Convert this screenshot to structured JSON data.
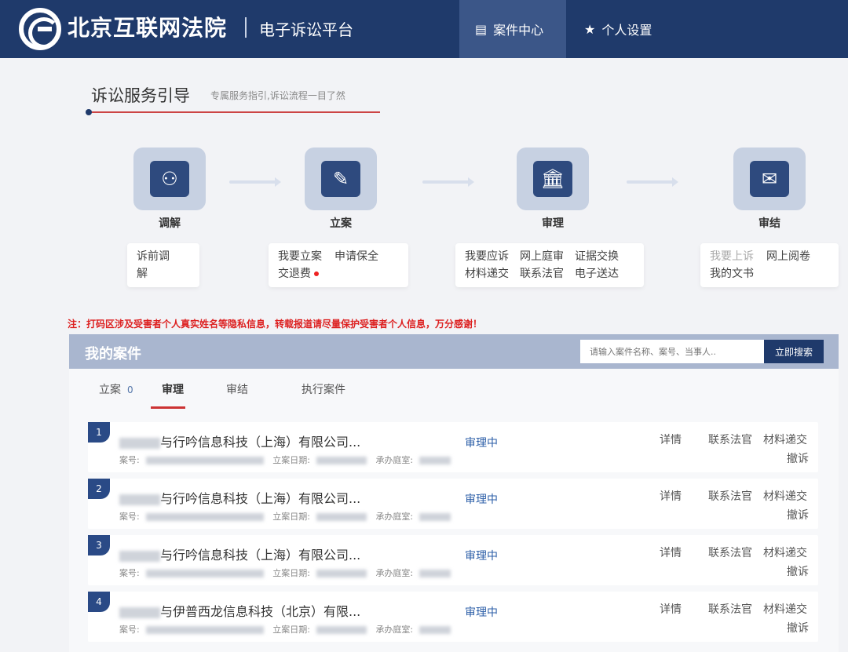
{
  "header": {
    "court_name": "北京互联网法院",
    "platform_name": "电子诉讼平台",
    "nav": [
      {
        "label": "案件中心",
        "icon": "list-icon",
        "active": true
      },
      {
        "label": "个人设置",
        "icon": "star-icon",
        "active": false
      }
    ],
    "colors": {
      "primary": "#1f3a6b",
      "active_tab": "#3b5688",
      "accent_red": "#cc3333"
    }
  },
  "guide": {
    "title": "诉讼服务引导",
    "subtitle": "专属服务指引,诉讼流程一目了然",
    "steps": [
      {
        "label": "调解",
        "icon": "mediation-icon",
        "links": [
          "诉前调解"
        ]
      },
      {
        "label": "立案",
        "icon": "filing-icon",
        "links": [
          "我要立案",
          "申请保全",
          "交退费"
        ]
      },
      {
        "label": "审理",
        "icon": "court-icon",
        "links": [
          "我要应诉",
          "网上庭审",
          "证据交换",
          "材料递交",
          "联系法官",
          "电子送达"
        ]
      },
      {
        "label": "审结",
        "icon": "verdict-icon",
        "links": [
          "我要上诉",
          "网上阅卷",
          "我的文书"
        ]
      }
    ]
  },
  "notice": "注：打码区涉及受害者个人真实姓名等隐私信息，转载报道请尽量保护受害者个人信息，万分感谢！",
  "cases": {
    "title": "我的案件",
    "search_placeholder": "请输入案件名称、案号、当事人..",
    "search_button": "立即搜索",
    "tabs": [
      {
        "label": "立案",
        "count": "0"
      },
      {
        "label": "审理",
        "active": true
      },
      {
        "label": "审结"
      },
      {
        "label": "执行案件"
      }
    ],
    "meta_labels": {
      "case_no": "案号:",
      "filing_date": "立案日期:",
      "courtroom": "承办庭室:"
    },
    "actions": {
      "detail": "详情",
      "contact": "联系法官",
      "submit": "材料递交",
      "withdraw": "撤诉"
    },
    "rows": [
      {
        "num": "1",
        "title": "与行吟信息科技（上海）有限公司...",
        "status": "审理中"
      },
      {
        "num": "2",
        "title": "与行吟信息科技（上海）有限公司...",
        "status": "审理中"
      },
      {
        "num": "3",
        "title": "与行吟信息科技（上海）有限公司...",
        "status": "审理中"
      },
      {
        "num": "4",
        "title": "与伊普西龙信息科技（北京）有限...",
        "status": "审理中"
      }
    ]
  }
}
